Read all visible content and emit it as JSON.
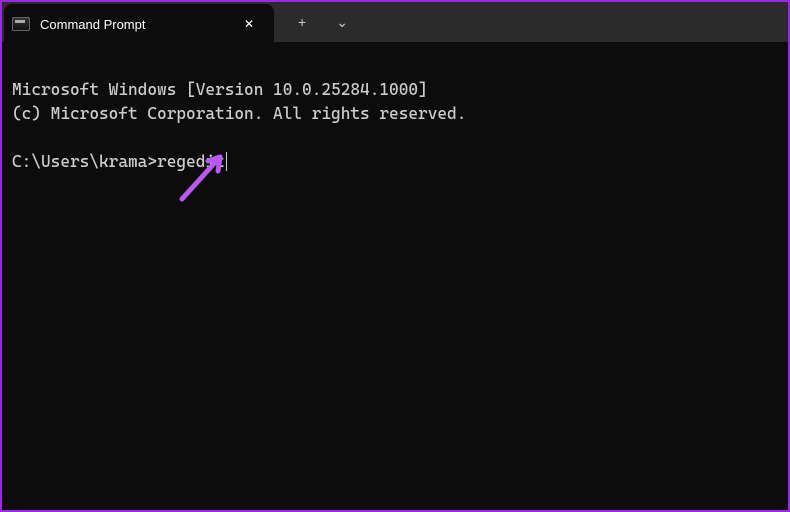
{
  "titlebar": {
    "tab": {
      "title": "Command Prompt",
      "close_label": "✕"
    },
    "new_tab_label": "+",
    "dropdown_label": "⌄"
  },
  "terminal": {
    "line1": "Microsoft Windows [Version 10.0.25284.1000]",
    "line2": "(c) Microsoft Corporation. All rights reserved.",
    "blank": "",
    "prompt": "C:\\Users\\krama>",
    "command": "regedit"
  },
  "annotation": {
    "arrow_color": "#b858f5"
  }
}
